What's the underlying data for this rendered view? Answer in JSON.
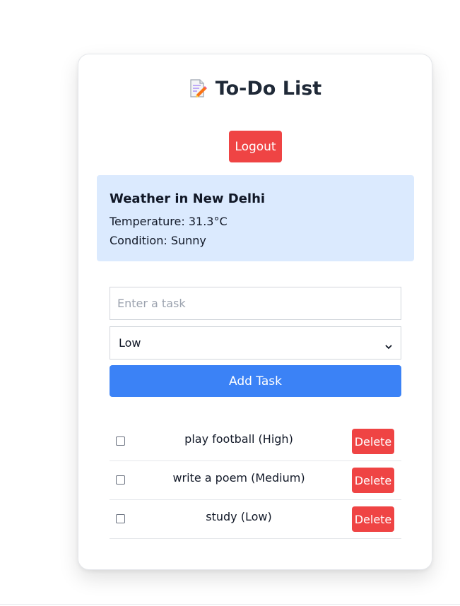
{
  "app": {
    "title": "To-Do List",
    "title_icon": "memo-icon"
  },
  "header": {
    "logout_label": "Logout"
  },
  "weather": {
    "heading": "Weather in New Delhi",
    "temperature_line": "Temperature: 31.3°C",
    "condition_line": "Condition: Sunny"
  },
  "form": {
    "task_placeholder": "Enter a task",
    "task_value": "",
    "priority_selected": "Low",
    "add_label": "Add Task"
  },
  "tasks": [
    {
      "label": "play football (High)",
      "checked": false,
      "delete_label": "Delete"
    },
    {
      "label": "write a poem (Medium)",
      "checked": false,
      "delete_label": "Delete"
    },
    {
      "label": "study (Low)",
      "checked": false,
      "delete_label": "Delete"
    }
  ],
  "colors": {
    "danger": "#ef4444",
    "primary": "#3b82f6",
    "weather_bg": "#dbeafe"
  }
}
